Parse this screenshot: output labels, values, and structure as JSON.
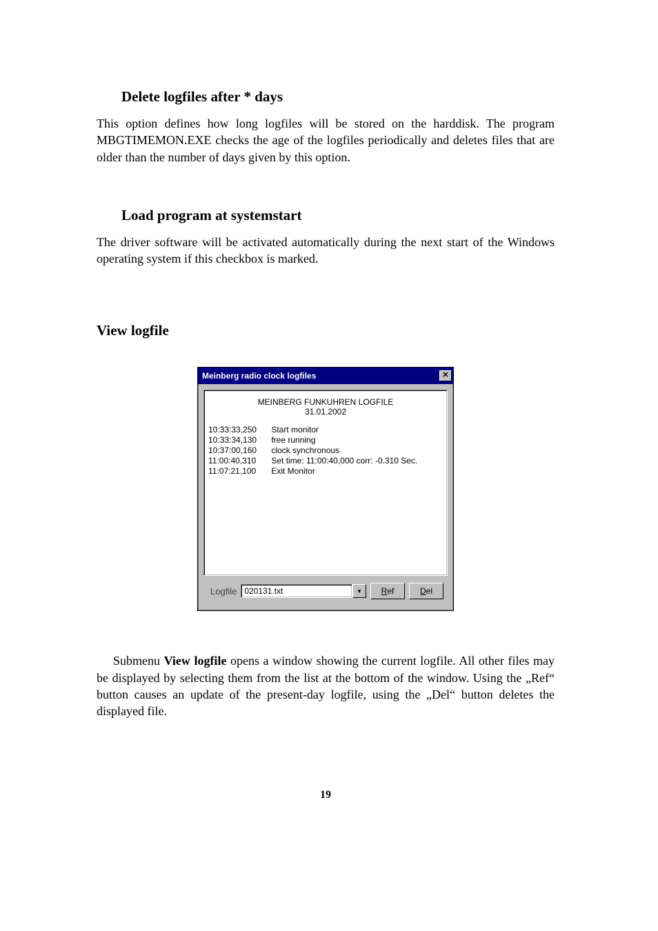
{
  "sections": {
    "delete": {
      "heading": "Delete logfiles after * days",
      "body": "This option defines how long logfiles will be stored on the harddisk. The program MBGTIMEMON.EXE checks the age of the logfiles periodically and deletes files that are older than the number of days given by this option."
    },
    "load": {
      "heading": "Load program at systemstart",
      "body": "The driver software will be activated automatically during the next start of the Windows operating system if this checkbox is marked."
    },
    "view": {
      "heading": "View logfile",
      "footer_prefix": "Submenu ",
      "footer_bold": "View logfile",
      "footer_rest": " opens a window showing the current logfile. All other files may be displayed by selecting them from the list at the bottom of the window. Using the „Ref“ button causes an update of the present-day logfile, using the „Del“ button deletes the displayed file."
    }
  },
  "dialog": {
    "title": "Meinberg radio clock logfiles",
    "close_glyph": "✕",
    "header_line1": "MEINBERG FUNKUHREN LOGFILE",
    "header_line2": "31.01.2002",
    "rows": [
      {
        "ts": "10:33:33,250",
        "msg": "Start monitor"
      },
      {
        "ts": "10:33:34,130",
        "msg": "free running"
      },
      {
        "ts": "10:37:00,160",
        "msg": "clock synchronous"
      },
      {
        "ts": "11:00:40,310",
        "msg": "Set time: 11:00:40,000   corr: -0.310  Sec."
      },
      {
        "ts": "11:07:21,100",
        "msg": "Exit Monitor"
      }
    ],
    "logfile_label": "Logfile",
    "logfile_value": "020131.txt",
    "dropdown_glyph": "▼",
    "ref_u": "R",
    "ref_rest": "ef",
    "del_u": "D",
    "del_rest": "el"
  },
  "page_number": "19"
}
